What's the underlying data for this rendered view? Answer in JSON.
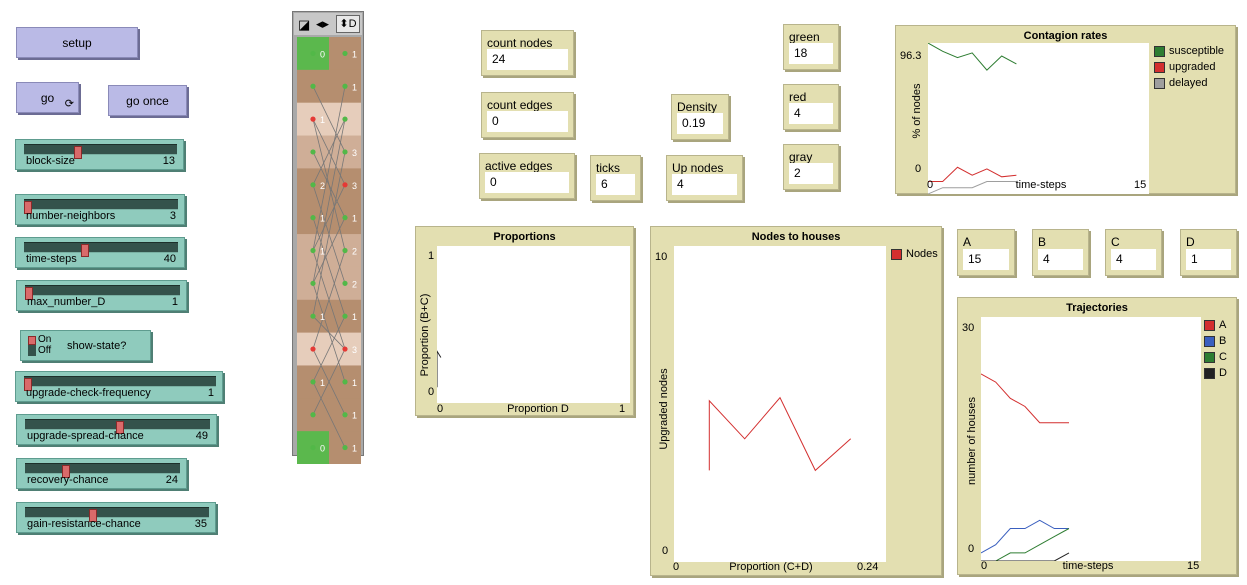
{
  "colors": {
    "button": "#babae6",
    "slider": "#8fcbbd",
    "monitor": "#e3dfb1",
    "patch_brown": "#b58e6f",
    "patch_light": "#e6cdbb",
    "patch_mid": "#cfae97",
    "patch_green": "#5bb84d",
    "green": "#2e7d32",
    "red": "#d32f2f",
    "gray": "#9e9e9e",
    "blue": "#3a5fbf",
    "black": "#222222"
  },
  "buttons": {
    "setup": "setup",
    "go": "go",
    "go_forever_icon": "loop-arrows-icon",
    "go_once": "go once"
  },
  "sliders": [
    {
      "label": "block-size",
      "value": "13",
      "fraction": 0.33
    },
    {
      "label": "number-neighbors",
      "value": "3",
      "fraction": 0.0
    },
    {
      "label": "time-steps",
      "value": "40",
      "fraction": 0.37
    },
    {
      "label": "max_number_D",
      "value": "1",
      "fraction": 0.0
    },
    {
      "label": "upgrade-check-frequency",
      "value": "1",
      "fraction": 0.0
    },
    {
      "label": "upgrade-spread-chance",
      "value": "49",
      "fraction": 0.49
    },
    {
      "label": "recovery-chance",
      "value": "24",
      "fraction": 0.24
    },
    {
      "label": "gain-resistance-chance",
      "value": "35",
      "fraction": 0.35
    }
  ],
  "switch": {
    "label": "show-state?",
    "on": "On",
    "off": "Off",
    "state": "on"
  },
  "view_toolbar": {
    "label": "D"
  },
  "view": {
    "left_labels": [
      "0",
      "1",
      "",
      "2",
      "1",
      "1",
      "",
      "1",
      "",
      "1",
      "",
      "0"
    ],
    "right_labels": [
      "1",
      "1",
      "3",
      "3",
      "1",
      "2",
      "2",
      "1",
      "3",
      "1",
      "1",
      "1"
    ]
  },
  "monitors": {
    "count_nodes": {
      "label": "count nodes",
      "value": "24"
    },
    "count_edges": {
      "label": "count edges",
      "value": "0"
    },
    "active_edges": {
      "label": "active edges",
      "value": "0"
    },
    "ticks": {
      "label": "ticks",
      "value": "6"
    },
    "density": {
      "label": "Density",
      "value": "0.19"
    },
    "up_nodes": {
      "label": "Up nodes",
      "value": "4"
    },
    "green": {
      "label": "green",
      "value": "18"
    },
    "red": {
      "label": "red",
      "value": "4"
    },
    "gray": {
      "label": "gray",
      "value": "2"
    },
    "A": {
      "label": "A",
      "value": "15"
    },
    "B": {
      "label": "B",
      "value": "4"
    },
    "C": {
      "label": "C",
      "value": "4"
    },
    "D": {
      "label": "D",
      "value": "1"
    }
  },
  "chart_data": [
    {
      "type": "line",
      "title": "Contagion rates",
      "xlabel": "time-steps",
      "ylabel": "% of nodes",
      "xlim": [
        0,
        15
      ],
      "ylim": [
        0,
        96.3
      ],
      "x_tick_labels": [
        "0",
        "15"
      ],
      "y_tick_labels": [
        "96.3",
        "0"
      ],
      "series": [
        {
          "name": "susceptible",
          "color": "#2e7d32",
          "x": [
            0,
            1,
            2,
            3,
            4,
            5,
            6
          ],
          "y": [
            96.3,
            91,
            87,
            90,
            79,
            88,
            83
          ]
        },
        {
          "name": "upgraded",
          "color": "#d32f2f",
          "x": [
            0,
            1,
            2,
            3,
            4,
            5,
            6
          ],
          "y": [
            8,
            8,
            17,
            12,
            16,
            11,
            12
          ]
        },
        {
          "name": "delayed",
          "color": "#9e9e9e",
          "x": [
            0,
            1,
            2,
            3,
            4,
            5,
            6
          ],
          "y": [
            0,
            4,
            4,
            4,
            8,
            8,
            8
          ]
        }
      ],
      "legend": "top-right"
    },
    {
      "type": "line",
      "title": "Proportions",
      "xlabel": "Proportion D",
      "ylabel": "Proportion (B+C)",
      "xlim": [
        0,
        1
      ],
      "ylim": [
        0,
        1
      ],
      "x_tick_labels": [
        "0",
        "1"
      ],
      "y_tick_labels": [
        "1",
        "0"
      ],
      "series": [
        {
          "color": "#222222",
          "x": [
            0,
            0,
            0.02
          ],
          "y": [
            0.1,
            0.33,
            0.29
          ]
        }
      ]
    },
    {
      "type": "line",
      "title": "Nodes to houses",
      "xlabel": "Proportion (C+D)",
      "ylabel": "Upgraded nodes",
      "xlim": [
        0,
        0.24
      ],
      "ylim": [
        0,
        10
      ],
      "x_tick_labels": [
        "0",
        "0.24"
      ],
      "y_tick_labels": [
        "10",
        "0"
      ],
      "series": [
        {
          "name": "Nodes",
          "color": "#d32f2f",
          "x": [
            0.04,
            0.04,
            0.08,
            0.12,
            0.16,
            0.2
          ],
          "y": [
            2.9,
            5.1,
            3.9,
            5.2,
            2.9,
            3.9
          ]
        }
      ],
      "legend": "top-right"
    },
    {
      "type": "line",
      "title": "Trajectories",
      "xlabel": "time-steps",
      "ylabel": "number of houses",
      "xlim": [
        0,
        15
      ],
      "ylim": [
        0,
        30
      ],
      "x_tick_labels": [
        "0",
        "15"
      ],
      "y_tick_labels": [
        "30",
        "0"
      ],
      "series": [
        {
          "name": "A",
          "color": "#d32f2f",
          "x": [
            0,
            1,
            2,
            3,
            4,
            5,
            6
          ],
          "y": [
            23,
            22,
            20,
            19,
            17,
            17,
            17
          ]
        },
        {
          "name": "B",
          "color": "#3a5fbf",
          "x": [
            0,
            1,
            2,
            3,
            4,
            5,
            6
          ],
          "y": [
            1,
            2,
            4,
            4,
            5,
            4,
            4
          ]
        },
        {
          "name": "C",
          "color": "#2e7d32",
          "x": [
            0,
            1,
            2,
            3,
            4,
            5,
            6
          ],
          "y": [
            0,
            0,
            1,
            1,
            2,
            3,
            4
          ]
        },
        {
          "name": "D",
          "color": "#222222",
          "x": [
            0,
            1,
            2,
            3,
            4,
            5,
            6
          ],
          "y": [
            0,
            0,
            0,
            0,
            0,
            0,
            1
          ]
        }
      ],
      "legend": "top-right"
    }
  ]
}
